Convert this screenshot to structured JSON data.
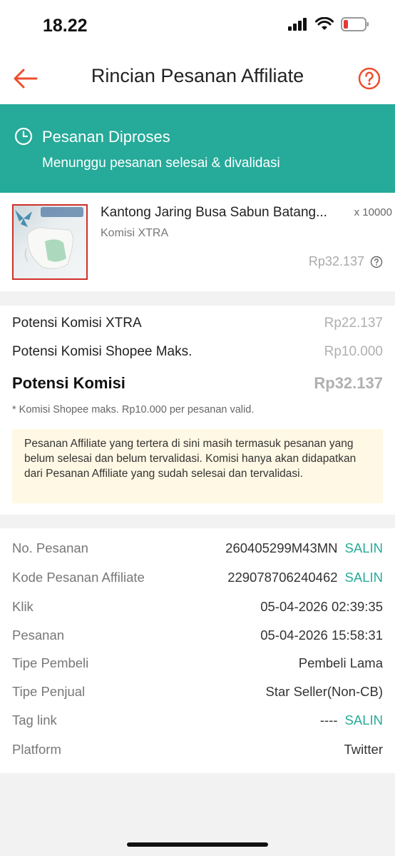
{
  "status_bar": {
    "time": "18.22"
  },
  "header": {
    "title": "Rincian Pesanan Affiliate"
  },
  "banner": {
    "status": "Pesanan Diproses",
    "subtitle": "Menunggu pesanan selesai & divalidasi"
  },
  "product": {
    "name": "Kantong Jaring Busa Sabun Batang...",
    "quantity": "x 10000",
    "tag": "Komisi XTRA",
    "price": "Rp32.137"
  },
  "commission": {
    "rows": [
      {
        "label": "Potensi Komisi XTRA",
        "value": "Rp22.137"
      },
      {
        "label": "Potensi Komisi Shopee Maks.",
        "value": "Rp10.000"
      }
    ],
    "total": {
      "label": "Potensi Komisi",
      "value": "Rp32.137"
    },
    "note": "* Komisi Shopee maks. Rp10.000 per pesanan valid.",
    "info": "Pesanan Affiliate yang tertera di sini masih termasuk pesanan yang belum selesai dan belum tervalidasi. Komisi hanya akan didapatkan dari Pesanan Affiliate yang sudah selesai dan tervalidasi."
  },
  "details": {
    "copy_label": "SALIN",
    "rows": [
      {
        "key": "No. Pesanan",
        "value": "260405299M43MN"
      },
      {
        "key": "Kode Pesanan Affiliate",
        "value": "229078706240462"
      },
      {
        "key": "Klik",
        "value": "05-04-2026 02:39:35"
      },
      {
        "key": "Pesanan",
        "value": "05-04-2026 15:58:31"
      },
      {
        "key": "Tipe Pembeli",
        "value": "Pembeli Lama"
      },
      {
        "key": "Tipe Penjual",
        "value": "Star Seller(Non-CB)"
      },
      {
        "key": "Tag link",
        "value": "----"
      },
      {
        "key": "Platform",
        "value": "Twitter"
      }
    ]
  },
  "colors": {
    "accent": "#ee4d2d",
    "teal": "#26aa99",
    "info_bg": "#fff8e4"
  },
  "icons": [
    "back-arrow-icon",
    "help-icon",
    "clock-icon",
    "info-icon",
    "signal-icon",
    "wifi-icon",
    "battery-icon"
  ]
}
